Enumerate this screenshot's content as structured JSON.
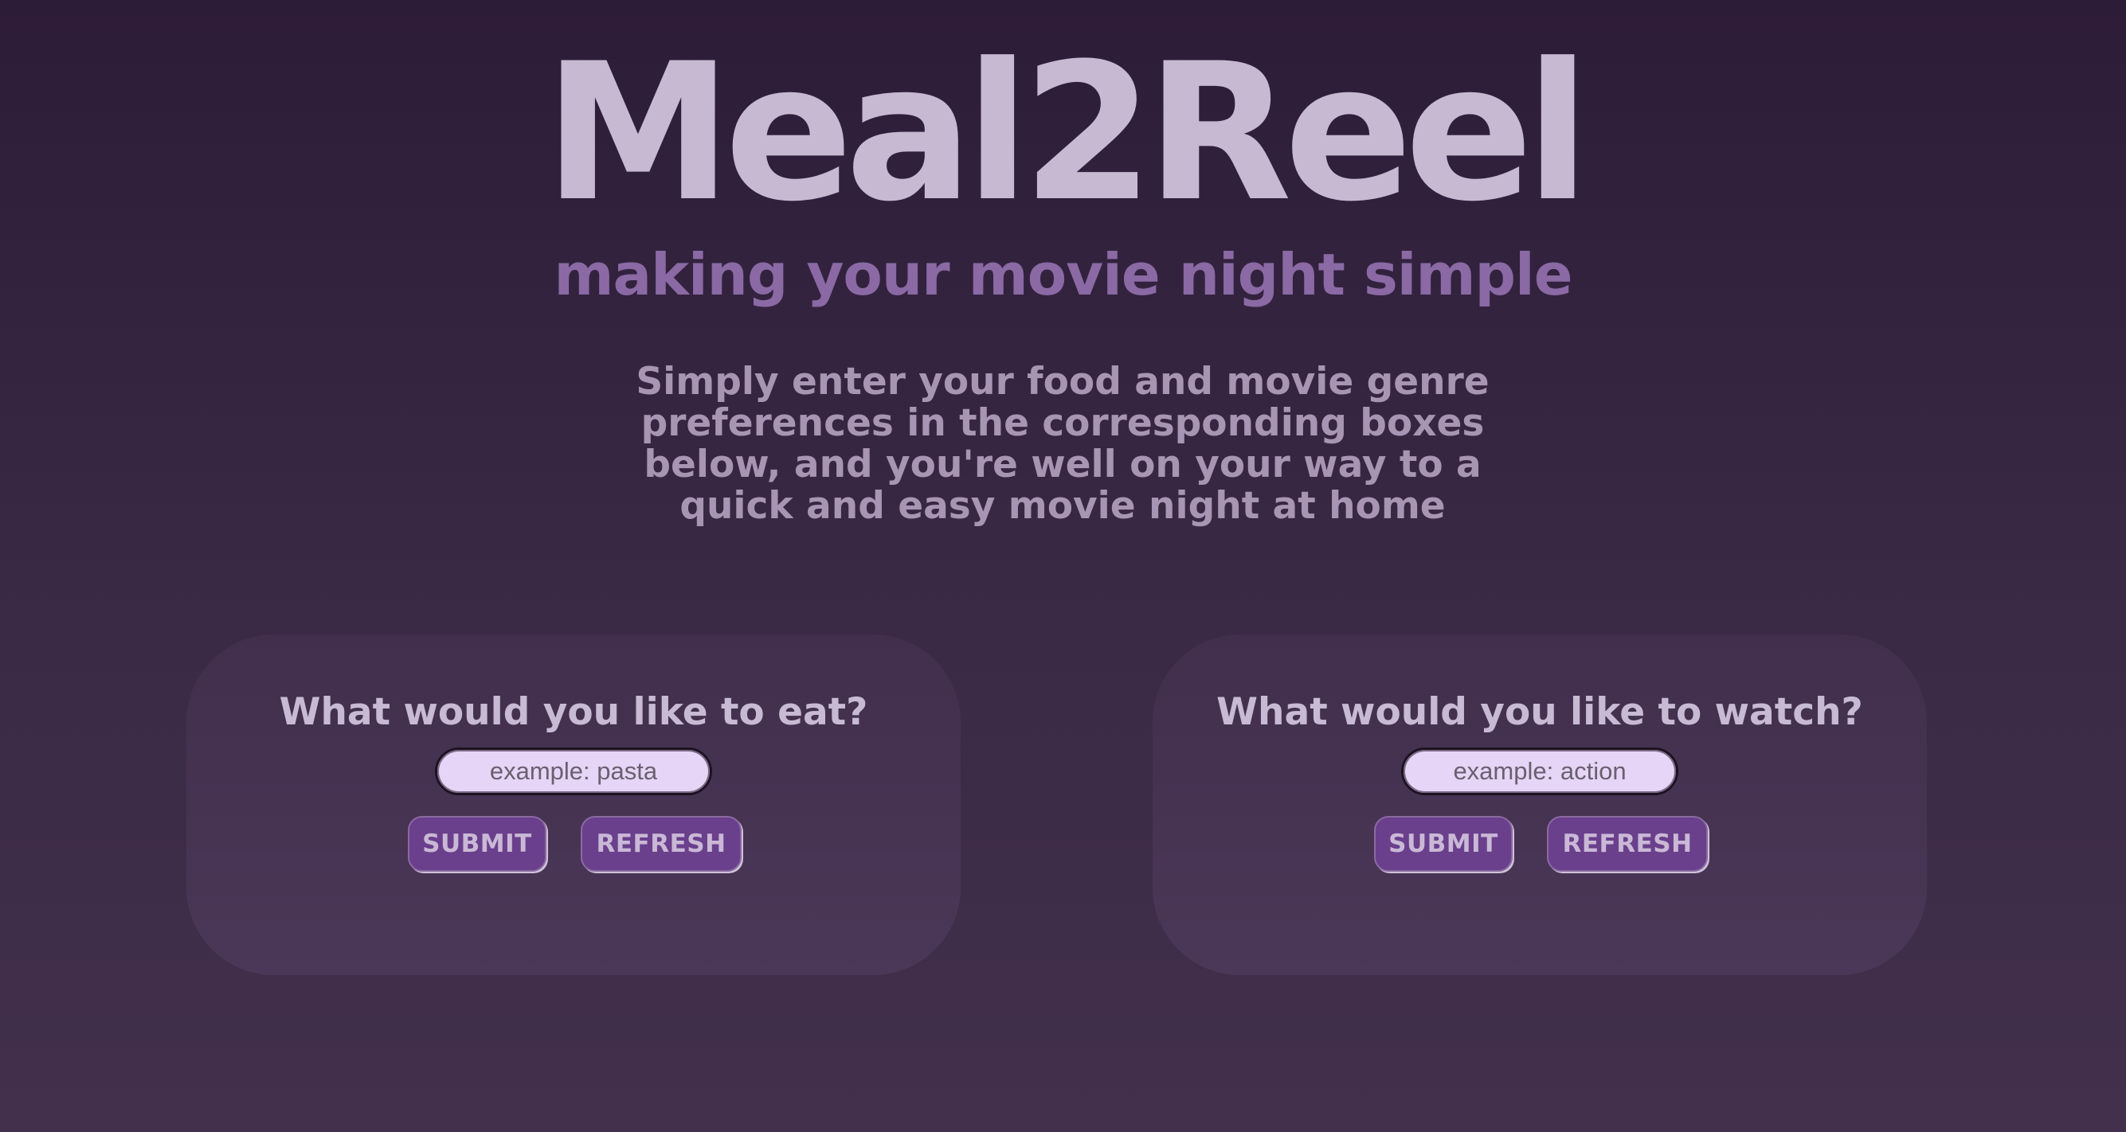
{
  "header": {
    "title": "Meal2Reel",
    "subtitle": "making your movie night simple"
  },
  "intro": {
    "text": "Simply enter your food and movie genre preferences in the corresponding boxes below, and you're well on your way to a quick and easy movie night at home"
  },
  "food_card": {
    "question": "What would you like to eat?",
    "input_placeholder": "example: pasta",
    "input_value": "",
    "submit_label": "SUBMIT",
    "refresh_label": "REFRESH"
  },
  "movie_card": {
    "question": "What would you like to watch?",
    "input_placeholder": "example: action",
    "input_value": "",
    "submit_label": "SUBMIT",
    "refresh_label": "REFRESH"
  },
  "colors": {
    "background_top": "#2d1c38",
    "background_bottom": "#42304c",
    "title": "#c7b9d2",
    "subtitle": "#8a69a4",
    "intro_text": "#a895b4",
    "card": "#463252",
    "input": "#e6d5f6",
    "button": "#6a3f8c",
    "button_text": "#c9b8d6"
  }
}
